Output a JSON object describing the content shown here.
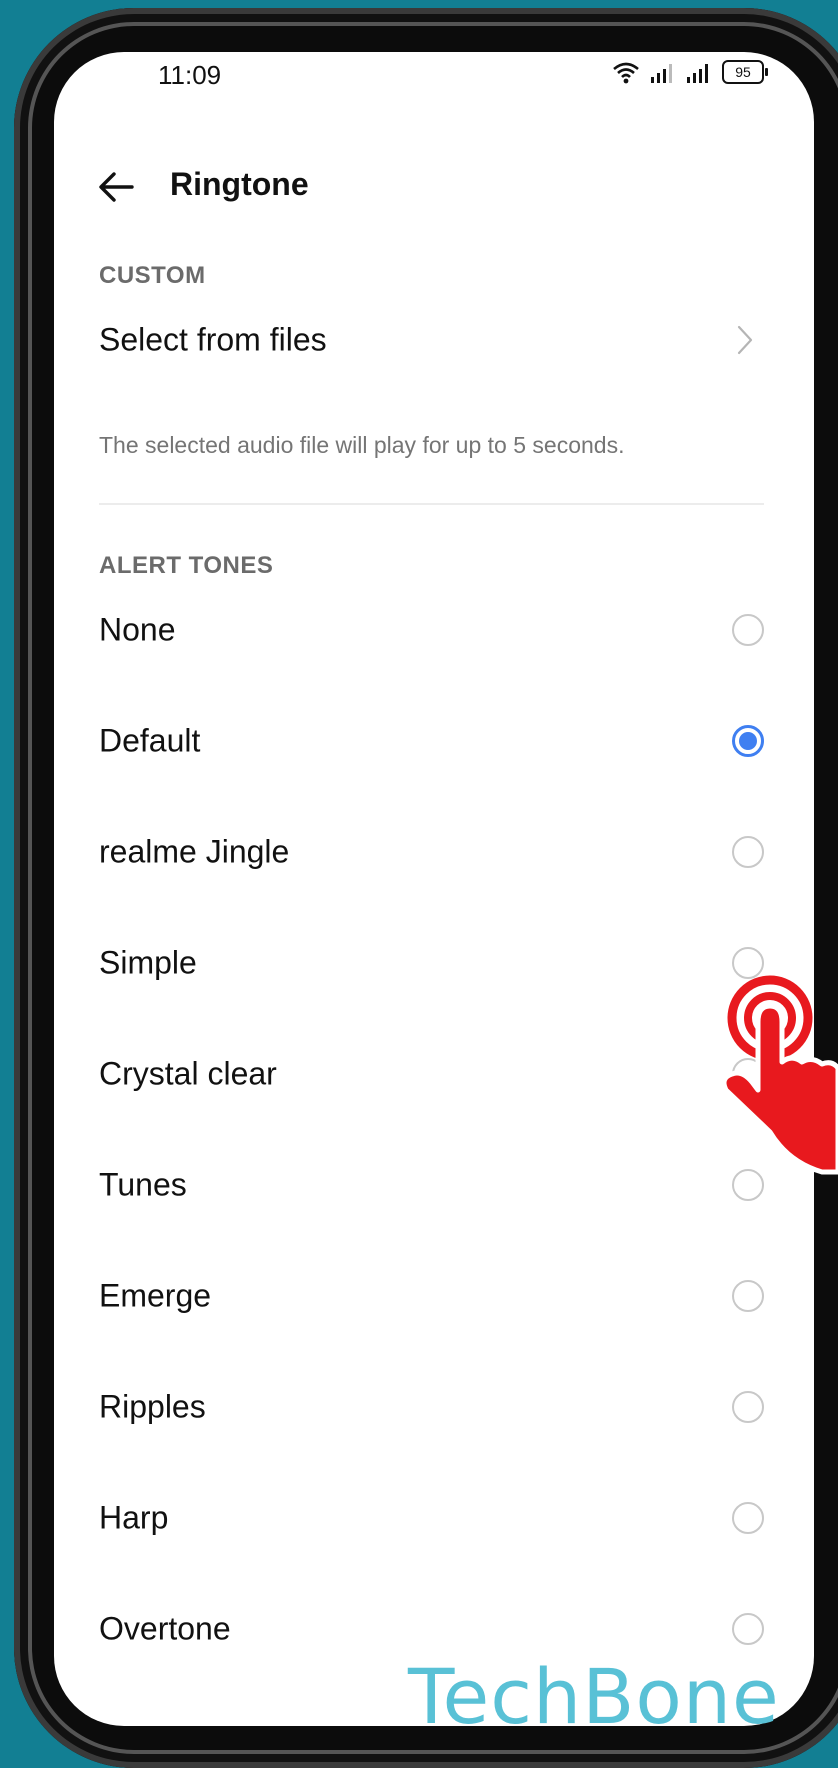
{
  "status_bar": {
    "time": "11:09",
    "battery": "95"
  },
  "header": {
    "title": "Ringtone"
  },
  "custom_section": {
    "label": "CUSTOM",
    "select_from_files": "Select from files",
    "helper": "The selected audio file will play for up to 5 seconds."
  },
  "alert_tones": {
    "label": "ALERT TONES",
    "items": [
      {
        "label": "None",
        "selected": false
      },
      {
        "label": "Default",
        "selected": true
      },
      {
        "label": "realme Jingle",
        "selected": false
      },
      {
        "label": "Simple",
        "selected": false
      },
      {
        "label": "Crystal clear",
        "selected": false
      },
      {
        "label": "Tunes",
        "selected": false
      },
      {
        "label": "Emerge",
        "selected": false
      },
      {
        "label": "Ripples",
        "selected": false
      },
      {
        "label": "Harp",
        "selected": false
      },
      {
        "label": "Overtone",
        "selected": false
      }
    ]
  },
  "watermark": "TechBone",
  "colors": {
    "accent": "#3f7ff1",
    "background": "#127f93",
    "tap_hand": "#e8191e"
  }
}
